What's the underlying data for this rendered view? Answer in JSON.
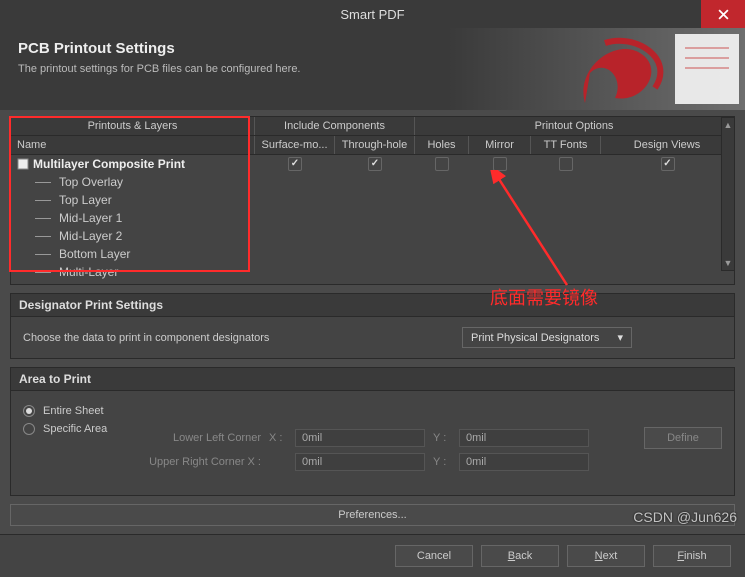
{
  "window": {
    "title": "Smart PDF"
  },
  "banner": {
    "heading": "PCB Printout Settings",
    "subtext": "The printout settings for PCB files can be configured here."
  },
  "grid": {
    "topHeaders": {
      "printouts": "Printouts & Layers",
      "include": "Include Components",
      "options": "Printout Options"
    },
    "subHeaders": {
      "name": "Name",
      "surface": "Surface-mo...",
      "through": "Through-hole",
      "holes": "Holes",
      "mirror": "Mirror",
      "tt": "TT Fonts",
      "design": "Design Views"
    },
    "mainRow": {
      "label": "Multilayer Composite Print",
      "surface": true,
      "through": true,
      "holes": false,
      "mirror": false,
      "tt": false,
      "design": true
    },
    "children": [
      "Top Overlay",
      "Top Layer",
      "Mid-Layer 1",
      "Mid-Layer 2",
      "Bottom Layer",
      "Multi-Layer"
    ]
  },
  "annotation": {
    "text": "底面需要镜像"
  },
  "designator": {
    "header": "Designator Print Settings",
    "label": "Choose the data to print in component designators",
    "dropdown": "Print Physical Designators"
  },
  "area": {
    "header": "Area to Print",
    "entire": "Entire Sheet",
    "specific": "Specific Area",
    "lowerLeft": "Lower Left Corner",
    "upperRight": "Upper Right Corner X :",
    "xLabel": "X :",
    "yLabel": "Y :",
    "llx": "0mil",
    "lly": "0mil",
    "urx": "0mil",
    "ury": "0mil",
    "define": "Define"
  },
  "buttons": {
    "preferences": "Preferences...",
    "cancel": "Cancel",
    "back": "Back",
    "next": "Next",
    "finish": "Finish"
  },
  "watermark": "CSDN @Jun626"
}
